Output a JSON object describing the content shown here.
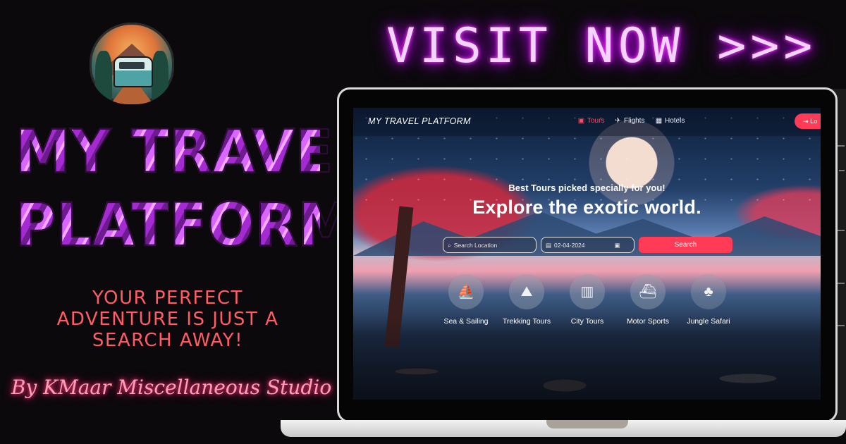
{
  "promo": {
    "title_lines": [
      "MY TRAVEL",
      "PLATFORM"
    ],
    "tagline_lines": [
      "YOUR PERFECT",
      "ADVENTURE IS JUST A",
      "SEARCH AWAY!"
    ],
    "studio": "By KMaar Miscellaneous Studio",
    "cta": "VISIT NOW >>>"
  },
  "app": {
    "brand": "MY TRAVEL PLATFORM",
    "nav": [
      {
        "label": "Tours",
        "icon": "suitcase-icon",
        "active": true
      },
      {
        "label": "Flights",
        "icon": "plane-icon",
        "active": false
      },
      {
        "label": "Hotels",
        "icon": "building-icon",
        "active": false
      }
    ],
    "login_label": "Lo",
    "hero": {
      "subtitle": "Best Tours picked specially for you!",
      "title": "Explore the exotic world."
    },
    "search": {
      "location_placeholder": "Search Location",
      "date_value": "02-04-2024",
      "button_label": "Search"
    },
    "categories": [
      {
        "label": "Sea & Sailing",
        "icon": "sailboat-icon"
      },
      {
        "label": "Trekking Tours",
        "icon": "hiker-icon"
      },
      {
        "label": "City Tours",
        "icon": "luggage-icon"
      },
      {
        "label": "Motor Sports",
        "icon": "speedboat-icon"
      },
      {
        "label": "Jungle Safari",
        "icon": "pine-tree-icon"
      }
    ]
  },
  "colors": {
    "accent": "#ff3b55",
    "neon_purple": "#d100ff",
    "tagline_red": "#ff5c66",
    "background": "#0b090c"
  }
}
